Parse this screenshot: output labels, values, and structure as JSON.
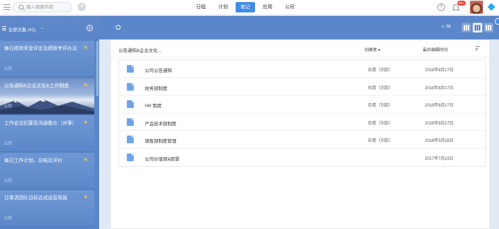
{
  "search": {
    "placeholder": "输入搜索内容"
  },
  "nav": {
    "tabs": [
      "日程",
      "计划",
      "笔记",
      "应用",
      "公司"
    ],
    "active_tab": "笔记"
  },
  "notifications": {
    "badge": "99+"
  },
  "sidebar": {
    "title": "全部文集 (41)",
    "items": [
      {
        "title": "每日绩效奖金评定及绩效考评办法",
        "tag": "公司",
        "starred": true
      },
      {
        "title": "公告通知&企业文化&工作制度",
        "tag": "公司",
        "starred": true,
        "active": true
      },
      {
        "title": "工作会议纪要及沟通备忘（对事）",
        "tag": "公司",
        "starred": true
      },
      {
        "title": "每日工作计划、总结及评价",
        "tag": "公司",
        "starred": true
      },
      {
        "title": "日事清团队目标达成运营周报",
        "tag": "公司",
        "starred": true
      }
    ]
  },
  "main": {
    "member_count": "56",
    "panel_title": "公告通知&企业文化...",
    "columns": {
      "creator": "创建者",
      "time": "最后编辑时间"
    },
    "rows": [
      {
        "name": "公司公告通知",
        "creator": "石卷（刘蕊）",
        "time": "2018年8月17日"
      },
      {
        "name": "财务部制度",
        "creator": "石卷（刘蕊）",
        "time": "2018年8月17日"
      },
      {
        "name": "HR 制度",
        "creator": "石卷（刘蕊）",
        "time": "2018年8月17日"
      },
      {
        "name": "产品技术部制度",
        "creator": "石卷（刘蕊）",
        "time": "2018年8月17日"
      },
      {
        "name": "销售部制度管理",
        "creator": "石卷（刘蕊）",
        "time": "2018年5月28日"
      },
      {
        "name": "公司价值观&愿景",
        "creator": "",
        "time": "2017年7月23日"
      }
    ]
  },
  "colors": {
    "accent": "#3f8be8",
    "sidebar": "#5b86c9",
    "star": "#f5c242",
    "doc_icon": "#6ea4e6"
  }
}
